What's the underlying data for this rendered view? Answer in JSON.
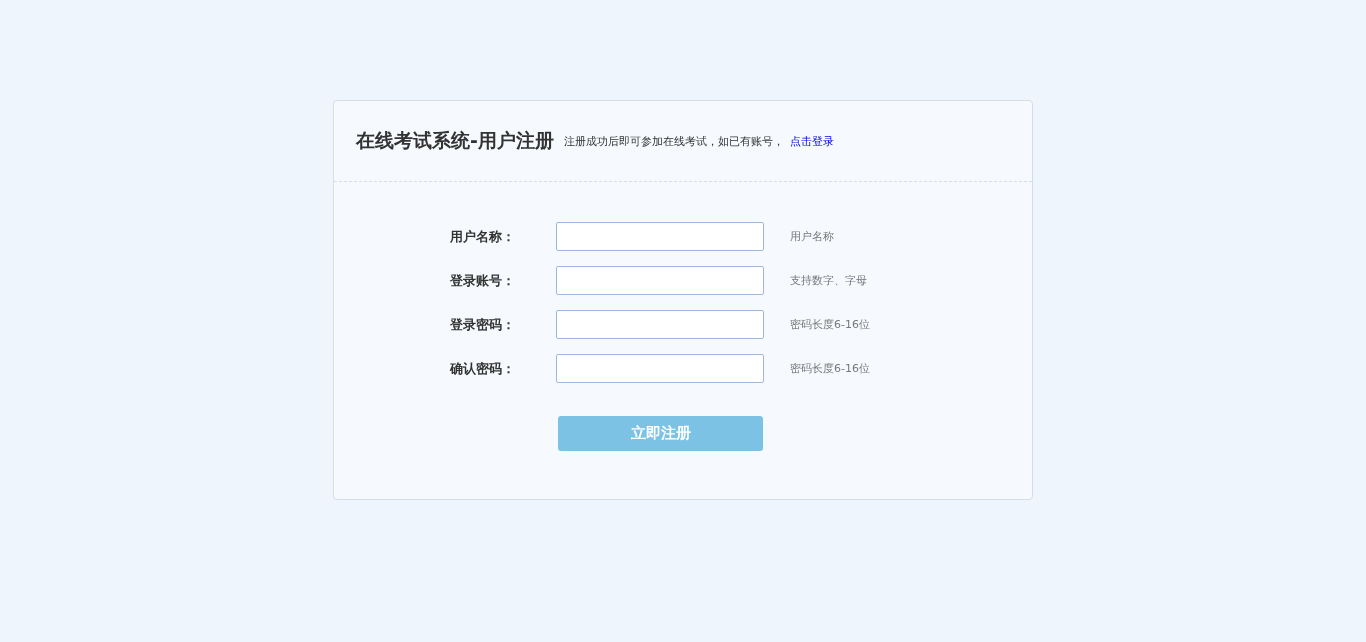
{
  "header": {
    "title": "在线考试系统-用户注册",
    "note": "注册成功后即可参加在线考试，如已有账号，",
    "login_link": "点击登录"
  },
  "fields": [
    {
      "label": "用户名称：",
      "hint": "用户名称"
    },
    {
      "label": "登录账号：",
      "hint": "支持数字、字母"
    },
    {
      "label": "登录密码：",
      "hint": "密码长度6-16位"
    },
    {
      "label": "确认密码：",
      "hint": "密码长度6-16位"
    }
  ],
  "submit_button": "立即注册"
}
